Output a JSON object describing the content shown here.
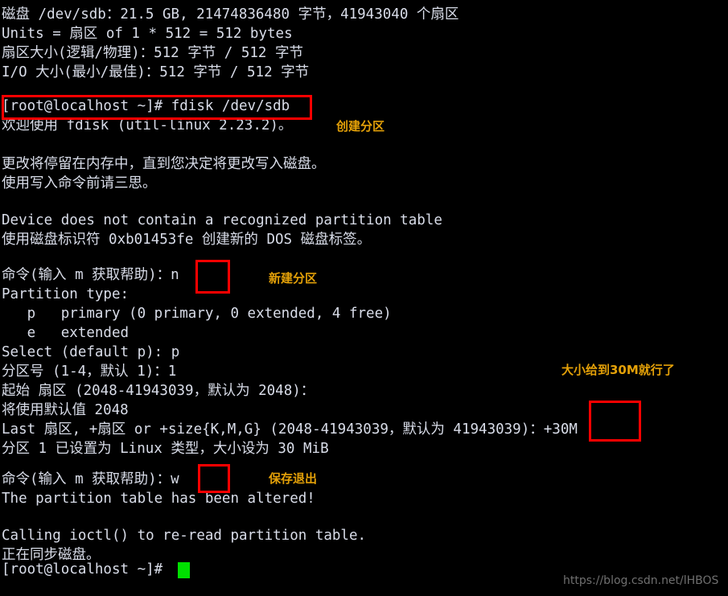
{
  "terminal": {
    "background_color": "#000000",
    "text_color": "#d9dde9",
    "cursor_color": "#00e000",
    "highlight_color": "#fe0000",
    "annotation_color": "#e3a008",
    "lines": [
      "磁盘 /dev/sdb：21.5 GB, 21474836480 字节，41943040 个扇区",
      "Units = 扇区 of 1 * 512 = 512 bytes",
      "扇区大小(逻辑/物理)：512 字节 / 512 字节",
      "I/O 大小(最小/最佳)：512 字节 / 512 字节",
      "",
      "[root@localhost ~]# fdisk /dev/sdb",
      "欢迎使用 fdisk (util-linux 2.23.2)。",
      "",
      "更改将停留在内存中，直到您决定将更改写入磁盘。",
      "使用写入命令前请三思。",
      "",
      "Device does not contain a recognized partition table",
      "使用磁盘标识符 0xb01453fe 创建新的 DOS 磁盘标签。",
      "",
      "命令(输入 m 获取帮助)：n",
      "Partition type:",
      "   p   primary (0 primary, 0 extended, 4 free)",
      "   e   extended",
      "Select (default p): p",
      "分区号 (1-4，默认 1)：1",
      "起始 扇区 (2048-41943039，默认为 2048)：",
      "将使用默认值 2048",
      "Last 扇区, +扇区 or +size{K,M,G} (2048-41943039，默认为 41943039)：+30M",
      "分区 1 已设置为 Linux 类型，大小设为 30 MiB",
      "",
      "命令(输入 m 获取帮助)：w",
      "The partition table has been altered!",
      "",
      "Calling ioctl() to re-read partition table.",
      "正在同步磁盘。",
      "[root@localhost ~]# "
    ]
  },
  "annotations": [
    {
      "id": "create-partition",
      "text": "创建分区"
    },
    {
      "id": "new-partition",
      "text": "新建分区"
    },
    {
      "id": "size-30m",
      "text": "大小给到30M就行了"
    },
    {
      "id": "save-and-exit",
      "text": "保存退出"
    }
  ],
  "highlights": [
    {
      "id": "fdisk-command",
      "label": "[root@localhost ~]# fdisk /dev/sdb"
    },
    {
      "id": "command-n",
      "label": "n"
    },
    {
      "id": "size-plus-30m",
      "label": "+30M"
    },
    {
      "id": "command-w",
      "label": "w"
    }
  ],
  "watermark": {
    "text": "https://blog.csdn.net/lHBOS"
  }
}
